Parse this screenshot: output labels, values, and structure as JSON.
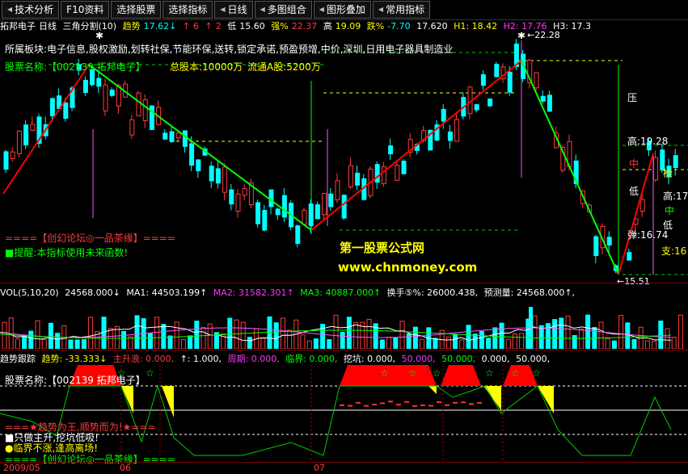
{
  "toolbar": {
    "items": [
      {
        "label": "技术分析",
        "arrow": true
      },
      {
        "label": "F10资料",
        "arrow": false
      },
      {
        "label": "选择股票",
        "arrow": false
      },
      {
        "label": "选择指标",
        "arrow": false
      },
      {
        "label": "日线",
        "arrow": true
      },
      {
        "label": "多图组合",
        "arrow": true
      },
      {
        "label": "图形叠加",
        "arrow": true
      },
      {
        "label": "常用指标",
        "arrow": true
      }
    ]
  },
  "header": {
    "stock": "拓邦电子",
    "period": "日线",
    "indicator": "三角分割(10)",
    "trend_label": "趋势",
    "trend_value": "17.62↓",
    "up_label": "↑",
    "up_value": "6",
    "up2_label": "↑",
    "up2_value": "2",
    "low_label": "低",
    "low_value": "15.60",
    "strong_label": "强%",
    "strong_value": "22.37",
    "high_label": "高",
    "high_value": "19.09",
    "fall_label": "跌%",
    "fall_value": "-7.70",
    "close_value": "17.620",
    "h1": "H1: 18.42",
    "h2": "H2: 17.76",
    "h3": "H3: 17.3"
  },
  "main": {
    "sector": "所属板块:电子信息,股权激励,划转社保,节能环保,送转,锁定承诺,预盈预增,中价,深圳,日用电子器具制造业",
    "name_line": "股票名称:【002139 拓邦电子】",
    "total_shares": "总股本:10000万",
    "float_shares": "流通A股:5200万",
    "forum": "====【创幻论坛◎一品茶缘】====",
    "warning": "■提醒:本指标使用未来函数!",
    "wm1": "第一股票公式网",
    "wm2": "www.chnmoney.com",
    "peak_label": "←22.28",
    "bottom_label": "←15.51",
    "right_labels": {
      "ya": "压",
      "gao": "高:19.28",
      "zhong": "中",
      "di": "低",
      "tan": "弹:16.74",
      "zhi": "支:16",
      "gao2": "高:17",
      "zhong2": "中",
      "di2": "低",
      "jian": "检"
    }
  },
  "volume": {
    "label": "VOL(5,10,20)",
    "vol": "24568.000↓",
    "ma1": "MA1: 44503.199↑",
    "ma2": "MA2: 31582.301↑",
    "ma3": "MA3: 40887.000↑",
    "turnover": "换手⑤%: 26000.438,",
    "forecast": "预测量: 24568.000↑,"
  },
  "trend": {
    "title": "趋势跟踪",
    "trend": "趋势: -33.333↓",
    "main_up": "主升浪: 0.000,",
    "one": "↑: 1.000,",
    "cycle": "周期: 0.000,",
    "critical": "临界: 0.000,",
    "dig": "挖坑: 0.000,",
    "v50a": "50.000,",
    "v50b": "50.000,",
    "v0": "0.000,",
    "v50c": "50.000,",
    "name_line": "股票名称:【002139 拓邦电子】",
    "slogan": "===★趋势为王,顺势而为!★===",
    "tip1": "■只做主升,挖坑低吸!",
    "tip2": "●临界不涨,逢高离场!",
    "forum": "====【创幻论坛◎一品茶缘】===="
  },
  "xaxis": {
    "d1": "2009/05",
    "d2": "06",
    "d3": "07"
  },
  "colors": {
    "up": "#ff3c3c",
    "down": "#00ffff",
    "ma_green": "#00ff00",
    "ma_red": "#ff0000",
    "fill_red": "#ff0000",
    "fill_yellow": "#ffff00"
  }
}
